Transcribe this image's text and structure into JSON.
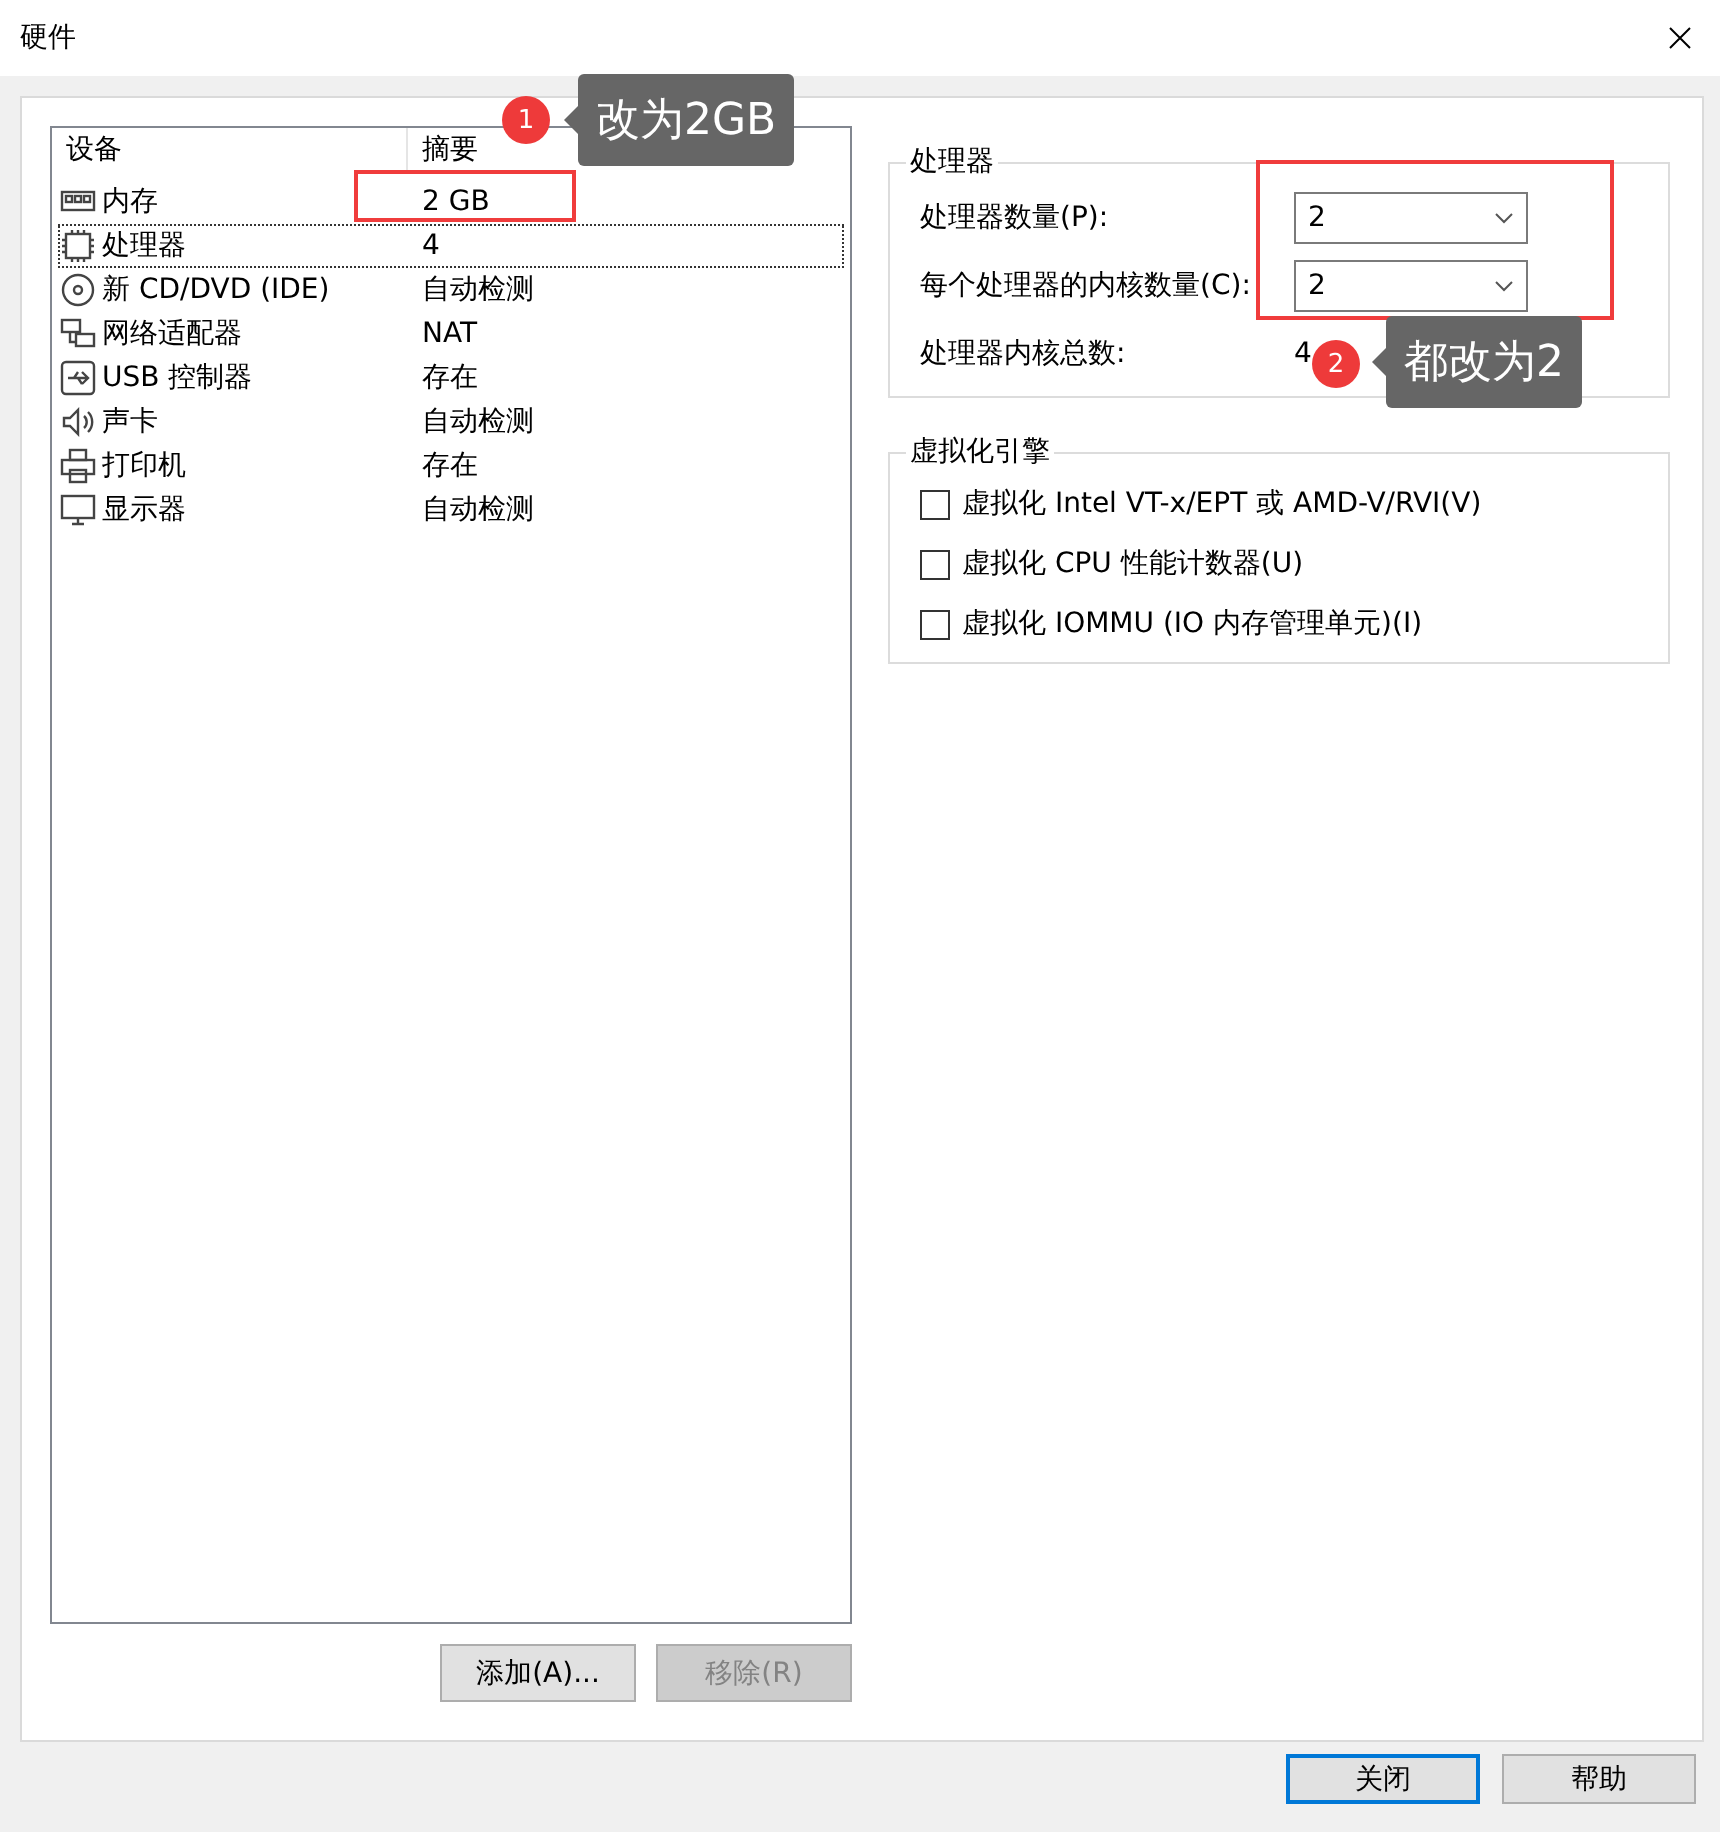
{
  "window": {
    "title": "硬件"
  },
  "device_list": {
    "columns": [
      "设备",
      "摘要"
    ],
    "rows": [
      {
        "kind": "memory",
        "name": "内存",
        "summary": "2 GB",
        "selected": false
      },
      {
        "kind": "cpu",
        "name": "处理器",
        "summary": "4",
        "selected": true
      },
      {
        "kind": "disc",
        "name": "新 CD/DVD (IDE)",
        "summary": "自动检测",
        "selected": false
      },
      {
        "kind": "network",
        "name": "网络适配器",
        "summary": "NAT",
        "selected": false
      },
      {
        "kind": "usb",
        "name": "USB 控制器",
        "summary": "存在",
        "selected": false
      },
      {
        "kind": "sound",
        "name": "声卡",
        "summary": "自动检测",
        "selected": false
      },
      {
        "kind": "printer",
        "name": "打印机",
        "summary": "存在",
        "selected": false
      },
      {
        "kind": "display",
        "name": "显示器",
        "summary": "自动检测",
        "selected": false
      }
    ]
  },
  "list_buttons": [
    {
      "label": "添加(A)...",
      "disabled": false
    },
    {
      "label": "移除(R)",
      "disabled": true
    }
  ],
  "processor": {
    "title": "处理器",
    "fields": [
      {
        "label": "处理器数量(P):",
        "value": "2"
      },
      {
        "label": "每个处理器的内核数量(C):",
        "value": "2"
      }
    ],
    "total_label": "处理器内核总数:",
    "total_value": "4"
  },
  "virtualization": {
    "title": "虚拟化引擎",
    "options": [
      {
        "label": "虚拟化 Intel VT-x/EPT 或 AMD-V/RVI(V)",
        "checked": false
      },
      {
        "label": "虚拟化 CPU 性能计数器(U)",
        "checked": false
      },
      {
        "label": "虚拟化 IOMMU (IO 内存管理单元)(I)",
        "checked": false
      }
    ]
  },
  "footer_buttons": [
    {
      "label": "关闭",
      "default": true
    },
    {
      "label": "帮助",
      "default": false
    }
  ],
  "annotations": [
    {
      "number": "1",
      "text": "改为2GB"
    },
    {
      "number": "2",
      "text": "都改为2"
    }
  ]
}
